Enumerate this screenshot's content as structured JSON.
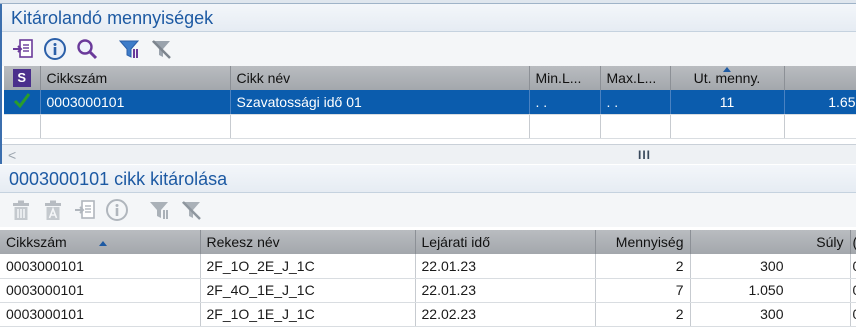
{
  "panel_top": {
    "title": "Kitárolandó mennyiségek",
    "s_badge": "S",
    "columns": [
      "Cikkszám",
      "Cikk név",
      "Min.L...",
      "Max.L...",
      "Ut. menny.",
      ""
    ],
    "rows": [
      {
        "status_icon": "checkmark-icon",
        "cikkszam": "0003000101",
        "cikk_nev": "Szavatossági idő 01",
        "min": ". .",
        "max": ". .",
        "ut_menny": "11",
        "extra": "1.65"
      }
    ],
    "scroll_grip": "III",
    "scroll_arrow": "<"
  },
  "panel_bottom": {
    "title": "0003000101 cikk kitárolása",
    "columns": [
      "Cikkszám",
      "Rekesz név",
      "Lejárati idő",
      "Mennyiség",
      "Súly",
      "("
    ],
    "rows": [
      {
        "cikkszam": "0003000101",
        "rekesz": "2F_1O_2E_J_1C",
        "lejarat": "22.01.23",
        "mennyiseg": "2",
        "suly": "300",
        "extra": "0"
      },
      {
        "cikkszam": "0003000101",
        "rekesz": "2F_4O_1E_J_1C",
        "lejarat": "22.01.23",
        "mennyiseg": "7",
        "suly": "1.050",
        "extra": "0"
      },
      {
        "cikkszam": "0003000101",
        "rekesz": "2F_1O_1E_J_1C",
        "lejarat": "22.02.23",
        "mennyiseg": "2",
        "suly": "300",
        "extra": "0"
      }
    ]
  },
  "colors": {
    "accent": "#1d5aa3",
    "selection": "#0b5cad",
    "header": "#a3a7ac",
    "check": "#2a9d2a"
  }
}
